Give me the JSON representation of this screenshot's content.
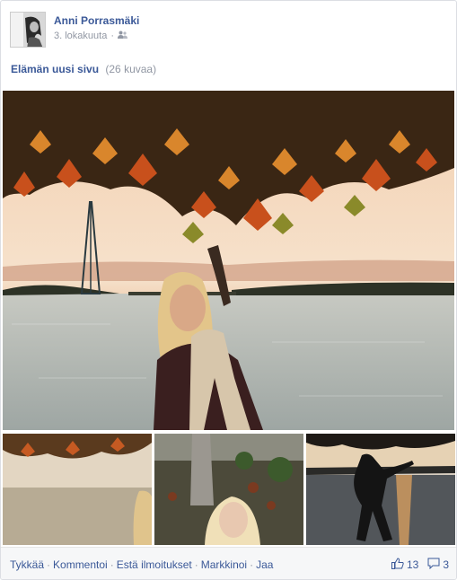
{
  "post": {
    "author": "Anni Porrasmäki",
    "date": "3. lokakuuta",
    "privacy_icon": "friends-icon"
  },
  "album": {
    "title": "Elämän uusi sivu",
    "count": "(26 kuvaa)"
  },
  "footer": {
    "like": "Tykkää",
    "comment": "Kommentoi",
    "block": "Estä ilmoitukset",
    "promote": "Markkinoi",
    "share": "Jaa",
    "likes_count": "13",
    "comments_count": "3",
    "separator": "·"
  }
}
